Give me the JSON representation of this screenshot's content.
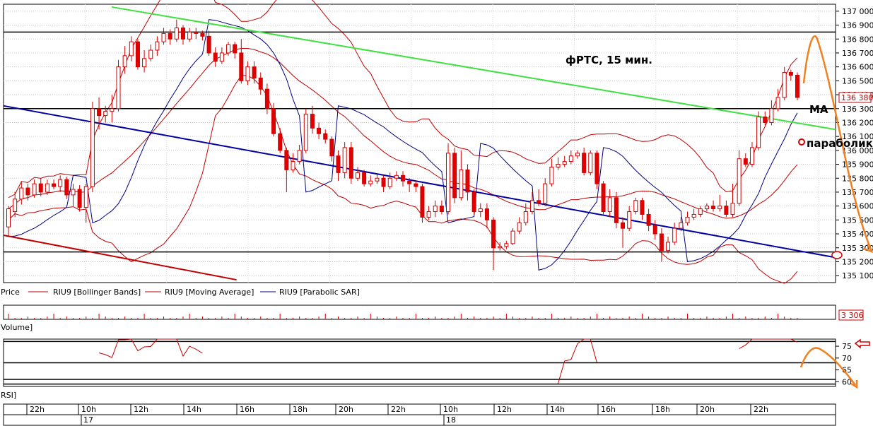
{
  "chart_data": {
    "type": "candlestick",
    "title": "фРТС,  15 мин.",
    "instrument": "RIU9",
    "interval": "15 мин.",
    "price_panel": {
      "label": "Price",
      "ylim": [
        135050,
        137050
      ],
      "y_ticks": [
        137000,
        136900,
        136800,
        136700,
        136600,
        136500,
        136400,
        136300,
        136200,
        136100,
        136000,
        135900,
        135800,
        135700,
        135600,
        135500,
        135400,
        135300,
        135200,
        135100
      ],
      "y_tick_labels": [
        "137 000",
        "136 900",
        "136 800",
        "136 700",
        "136 600",
        "136 500",
        "136 400",
        "136 300",
        "136 200",
        "136 100",
        "136 000",
        "135 900",
        "135 800",
        "135 700",
        "135 600",
        "135 500",
        "135 400",
        "135 300",
        "135 200",
        "135 100"
      ],
      "last_price": 136380,
      "last_price_label": "136 380",
      "legend": [
        {
          "name": "Price",
          "color": "#000000"
        },
        {
          "name": "RIU9 [Bollinger Bands]",
          "color": "#c00000"
        },
        {
          "name": "RIU9 [Moving Average]",
          "color": "#c00000"
        },
        {
          "name": "RIU9 [Parabolic SAR]",
          "color": "#000080"
        }
      ],
      "annotations": [
        {
          "text": "МА",
          "y": 136300
        },
        {
          "text": "параболик",
          "y": 136050
        }
      ],
      "horizontal_levels": [
        136850,
        136300,
        135270
      ],
      "trendlines": {
        "green": [
          [
            0.13,
            137030
          ],
          [
            1.0,
            136150
          ]
        ],
        "blue": [
          [
            0.0,
            136320
          ],
          [
            1.0,
            135230
          ]
        ],
        "red": [
          [
            0.0,
            135390
          ],
          [
            0.28,
            135070
          ]
        ]
      },
      "candles": [
        [
          135450,
          135580,
          135380,
          135600
        ],
        [
          135560,
          135650,
          135520,
          135700
        ],
        [
          135650,
          135730,
          135610,
          135780
        ],
        [
          135730,
          135680,
          135640,
          135760
        ],
        [
          135680,
          135760,
          135660,
          135790
        ],
        [
          135760,
          135700,
          135670,
          135800
        ],
        [
          135700,
          135760,
          135680,
          135790
        ],
        [
          135760,
          135740,
          135720,
          135790
        ],
        [
          135740,
          135790,
          135700,
          135820
        ],
        [
          135790,
          135680,
          135650,
          135810
        ],
        [
          135680,
          135720,
          135600,
          135760
        ],
        [
          135720,
          135590,
          135560,
          135750
        ],
        [
          135590,
          135740,
          135480,
          135760
        ],
        [
          135740,
          136300,
          135700,
          136350
        ],
        [
          136300,
          136250,
          136150,
          136380
        ],
        [
          136250,
          136280,
          136200,
          136320
        ],
        [
          136280,
          136300,
          136200,
          136400
        ],
        [
          136300,
          136600,
          136280,
          136650
        ],
        [
          136600,
          136680,
          136550,
          136750
        ],
        [
          136680,
          136780,
          136640,
          136820
        ],
        [
          136780,
          136600,
          136580,
          136800
        ],
        [
          136600,
          136660,
          136560,
          136720
        ],
        [
          136660,
          136720,
          136640,
          136760
        ],
        [
          136720,
          136780,
          136680,
          136820
        ],
        [
          136780,
          136840,
          136760,
          136880
        ],
        [
          136840,
          136800,
          136760,
          136870
        ],
        [
          136800,
          136880,
          136780,
          136940
        ],
        [
          136880,
          136800,
          136760,
          136900
        ],
        [
          136800,
          136850,
          136780,
          136880
        ],
        [
          136850,
          136840,
          136800,
          136880
        ],
        [
          136840,
          136820,
          136790,
          136860
        ],
        [
          136820,
          136700,
          136680,
          136860
        ],
        [
          136700,
          136640,
          136600,
          136740
        ],
        [
          136640,
          136700,
          136620,
          136740
        ],
        [
          136700,
          136760,
          136680,
          136780
        ],
        [
          136760,
          136700,
          136660,
          136780
        ],
        [
          136700,
          136500,
          136480,
          136800
        ],
        [
          136500,
          136600,
          136470,
          136640
        ],
        [
          136600,
          136520,
          136480,
          136640
        ],
        [
          136520,
          136440,
          136400,
          136560
        ],
        [
          136440,
          136300,
          136260,
          136480
        ],
        [
          136300,
          136120,
          136100,
          136340
        ],
        [
          136120,
          136000,
          135980,
          136160
        ],
        [
          136000,
          135860,
          135700,
          136020
        ],
        [
          135860,
          135920,
          135840,
          135980
        ],
        [
          135920,
          136000,
          135900,
          136040
        ],
        [
          136000,
          136260,
          135980,
          136300
        ],
        [
          136260,
          136160,
          136120,
          136320
        ],
        [
          136160,
          136120,
          136080,
          136200
        ],
        [
          136120,
          136080,
          136050,
          136150
        ],
        [
          136080,
          135960,
          135920,
          136100
        ],
        [
          135960,
          135840,
          135780,
          136000
        ],
        [
          135840,
          136020,
          135800,
          136060
        ],
        [
          136020,
          135800,
          135760,
          136060
        ],
        [
          135800,
          135840,
          135780,
          135880
        ],
        [
          135840,
          135760,
          135740,
          135860
        ],
        [
          135760,
          135780,
          135740,
          135820
        ],
        [
          135780,
          135800,
          135760,
          135830
        ],
        [
          135800,
          135740,
          135700,
          135820
        ],
        [
          135740,
          135800,
          135720,
          135840
        ],
        [
          135800,
          135820,
          135780,
          135850
        ],
        [
          135820,
          135780,
          135740,
          135850
        ],
        [
          135780,
          135760,
          135700,
          135800
        ],
        [
          135760,
          135740,
          135700,
          135780
        ],
        [
          135740,
          135520,
          135480,
          135760
        ],
        [
          135520,
          135560,
          135500,
          135600
        ],
        [
          135560,
          135600,
          135520,
          135640
        ],
        [
          135600,
          135560,
          135540,
          135640
        ],
        [
          135560,
          135980,
          135540,
          136050
        ],
        [
          135980,
          135660,
          135620,
          136020
        ],
        [
          135660,
          135860,
          135640,
          136000
        ],
        [
          135860,
          135700,
          135640,
          135900
        ],
        [
          135700,
          135560,
          135540,
          135720
        ],
        [
          135560,
          135580,
          135520,
          135620
        ],
        [
          135580,
          135500,
          135440,
          135620
        ],
        [
          135500,
          135300,
          135140,
          135520
        ],
        [
          135300,
          135310,
          135280,
          135340
        ],
        [
          135310,
          135330,
          135290,
          135350
        ],
        [
          135330,
          135420,
          135320,
          135440
        ],
        [
          135420,
          135480,
          135400,
          135520
        ],
        [
          135480,
          135560,
          135460,
          135620
        ],
        [
          135560,
          135640,
          135540,
          135700
        ],
        [
          135640,
          135620,
          135600,
          135720
        ],
        [
          135620,
          135760,
          135600,
          135800
        ],
        [
          135760,
          135880,
          135740,
          135940
        ],
        [
          135880,
          135900,
          135860,
          135950
        ],
        [
          135900,
          135920,
          135880,
          135960
        ],
        [
          135920,
          135960,
          135900,
          136000
        ],
        [
          135960,
          135980,
          135940,
          136000
        ],
        [
          135980,
          135840,
          135820,
          136020
        ],
        [
          135840,
          135980,
          135820,
          136000
        ],
        [
          135980,
          135760,
          135720,
          136000
        ],
        [
          135760,
          135560,
          135540,
          135780
        ],
        [
          135560,
          135660,
          135520,
          135720
        ],
        [
          135660,
          135480,
          135440,
          135700
        ],
        [
          135480,
          135440,
          135300,
          135520
        ],
        [
          135440,
          135560,
          135420,
          135600
        ],
        [
          135560,
          135640,
          135540,
          135660
        ],
        [
          135640,
          135540,
          135500,
          135660
        ],
        [
          135540,
          135460,
          135420,
          135580
        ],
        [
          135460,
          135400,
          135360,
          135500
        ],
        [
          135400,
          135280,
          135200,
          135440
        ],
        [
          135280,
          135340,
          135260,
          135380
        ],
        [
          135340,
          135440,
          135320,
          135480
        ],
        [
          135440,
          135480,
          135420,
          135520
        ],
        [
          135480,
          135520,
          135460,
          135560
        ],
        [
          135520,
          135540,
          135500,
          135580
        ],
        [
          135540,
          135580,
          135520,
          135600
        ],
        [
          135580,
          135600,
          135560,
          135620
        ],
        [
          135600,
          135580,
          135560,
          135640
        ],
        [
          135580,
          135600,
          135560,
          135680
        ],
        [
          135600,
          135540,
          135520,
          135640
        ],
        [
          135540,
          135620,
          135520,
          135760
        ],
        [
          135620,
          135940,
          135600,
          136000
        ],
        [
          135940,
          135900,
          135880,
          135980
        ],
        [
          135900,
          136020,
          135880,
          136060
        ],
        [
          136020,
          136240,
          136000,
          136280
        ],
        [
          136240,
          136200,
          136180,
          136280
        ],
        [
          136200,
          136300,
          136180,
          136360
        ],
        [
          136300,
          136380,
          136280,
          136440
        ],
        [
          136380,
          136560,
          136360,
          136600
        ],
        [
          136560,
          136540,
          136500,
          136580
        ],
        [
          136540,
          136380,
          136360,
          136560
        ]
      ]
    },
    "volume_panel": {
      "label": "Volume]",
      "last_value": 3306,
      "last_value_label": "3 306"
    },
    "rsi_panel": {
      "label": "RSI]",
      "ylim": [
        58,
        78
      ],
      "y_ticks": [
        75,
        70,
        65,
        60
      ],
      "y_tick_labels": [
        "75",
        "70",
        "65",
        "60"
      ],
      "levels": [
        77,
        68,
        61,
        59
      ]
    },
    "x_axis": {
      "tick_labels": [
        "22h",
        "10h",
        "12h",
        "14h",
        "16h",
        "18h",
        "20h",
        "22h",
        "10h",
        "12h",
        "14h",
        "16h",
        "18h",
        "20h",
        "22h"
      ],
      "date_labels": [
        "17",
        "18"
      ]
    }
  }
}
